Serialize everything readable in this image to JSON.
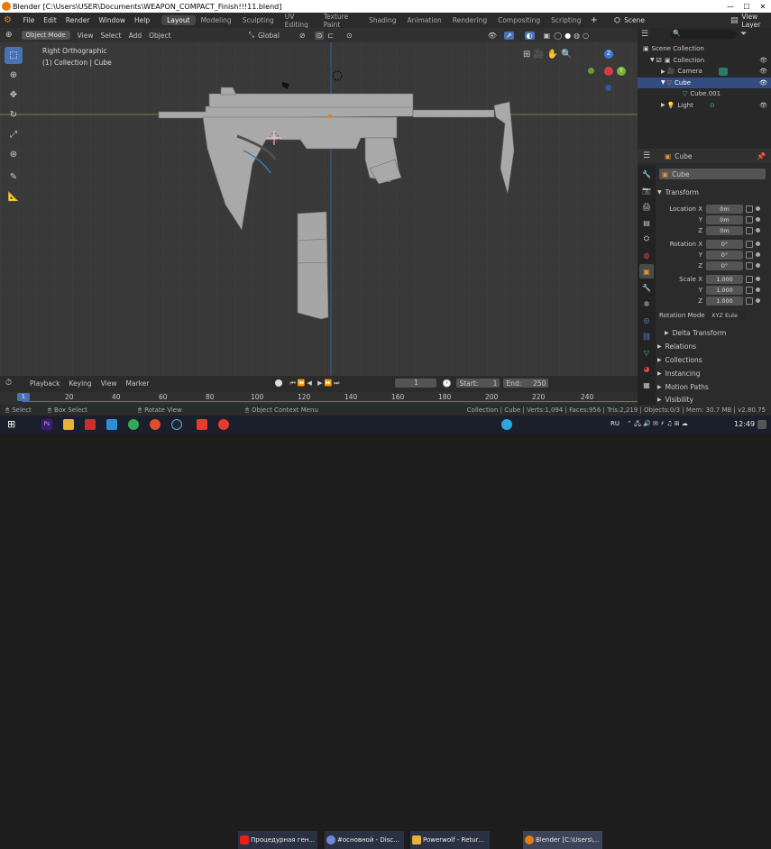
{
  "window": {
    "title": "Blender [C:\\Users\\USER\\Documents\\WEAPON_COMPACT_Finish!!!11.blend]",
    "minimize": "—",
    "maximize": "☐",
    "close": "✕"
  },
  "menu": [
    "File",
    "Edit",
    "Render",
    "Window",
    "Help"
  ],
  "workspaces": [
    "Layout",
    "Modeling",
    "Sculpting",
    "UV Editing",
    "Texture Paint",
    "Shading",
    "Animation",
    "Rendering",
    "Compositing",
    "Scripting"
  ],
  "scene": {
    "label": "Scene",
    "view_layer": "View Layer"
  },
  "viewport_header": {
    "mode": "Object Mode",
    "view": "View",
    "select": "Select",
    "add": "Add",
    "object": "Object",
    "transform_orientation": "Global"
  },
  "viewport": {
    "view_name": "Right Orthographic",
    "collection_info": "(1) Collection | Cube",
    "gizmo": {
      "y": "Y",
      "z": "Z"
    }
  },
  "outliner": {
    "title": "Scene Collection",
    "rows": [
      {
        "label": "Collection"
      },
      {
        "label": "Camera"
      },
      {
        "label": "Cube"
      },
      {
        "label": "Cube.001"
      },
      {
        "label": "Light"
      }
    ]
  },
  "properties": {
    "object_name": "Cube",
    "object_field": "Cube",
    "transform_title": "Transform",
    "location": {
      "label": "Location X",
      "x": "0m",
      "y": "0m",
      "z": "0m"
    },
    "rotation": {
      "label": "Rotation X",
      "x": "0°",
      "y": "0°",
      "z": "0°"
    },
    "scale": {
      "label": "Scale X",
      "x": "1.000",
      "y": "1.000",
      "z": "1.000"
    },
    "axis": {
      "y": "Y",
      "z": "Z"
    },
    "rotation_mode_label": "Rotation Mode",
    "rotation_mode": "XYZ Eule",
    "sections": [
      "Delta Transform",
      "Relations",
      "Collections",
      "Instancing",
      "Motion Paths",
      "Visibility"
    ]
  },
  "timeline": {
    "playback": "Playback",
    "keying": "Keying",
    "view": "View",
    "marker": "Marker",
    "current_frame": "1",
    "start_label": "Start:",
    "start": "1",
    "end_label": "End:",
    "end": "250",
    "ruler": [
      "1",
      "20",
      "40",
      "60",
      "80",
      "100",
      "120",
      "140",
      "160",
      "180",
      "200",
      "220",
      "240"
    ]
  },
  "statusbar": {
    "select": "Select",
    "box_select": "Box Select",
    "rotate_view": "Rotate View",
    "context_menu": "Object Context Menu",
    "stats": "Collection | Cube | Verts:1,094 | Faces:956 | Tris:2,219 | Objects:0/3 | Mem: 30.7 MB | v2.80.75"
  },
  "taskbar": {
    "items": [
      "Процедурная ген...",
      "#основной - Disc...",
      "Powerwolf - Retur...",
      "Blender [C:\\Users\\..."
    ],
    "lang": "RU",
    "time": "12:49"
  }
}
